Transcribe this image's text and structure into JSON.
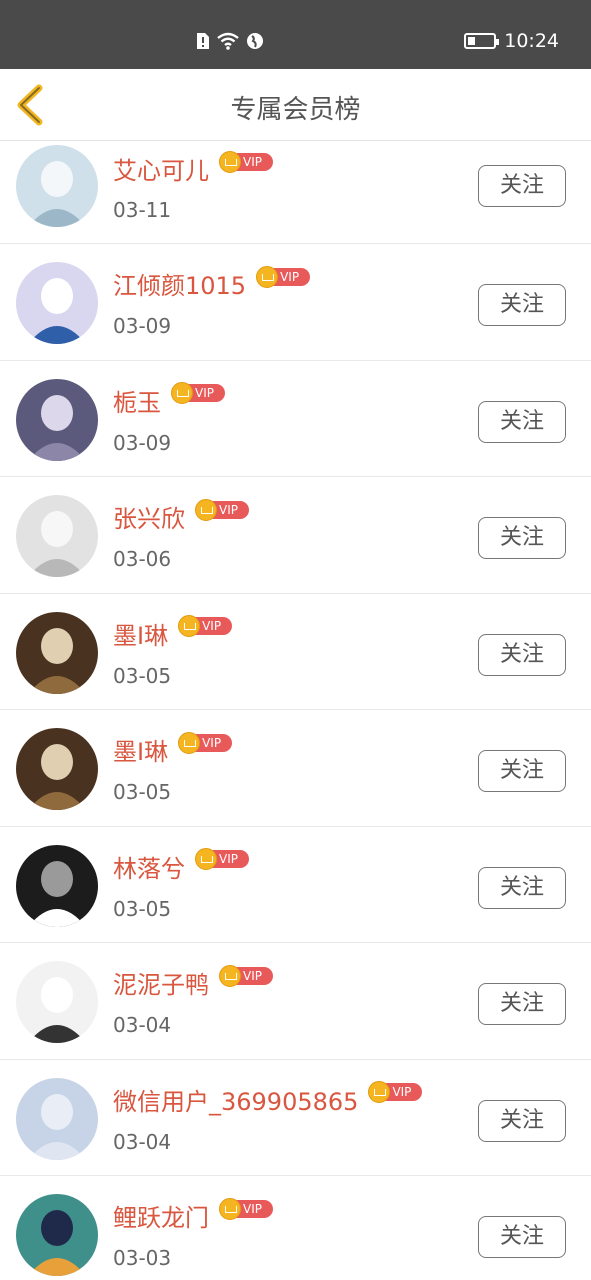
{
  "status_bar": {
    "time": "10:24",
    "battery_level": 0.25
  },
  "header": {
    "title": "专属会员榜",
    "back_icon": "chevron-left-icon"
  },
  "vip_label": "VIP",
  "members": [
    {
      "name": "艾心可儿",
      "date": "03-11",
      "follow": "关注",
      "avatar_colors": [
        "#cfe0ea",
        "#f4f7fa",
        "#9cb8c8"
      ]
    },
    {
      "name": "江倾颜1015",
      "date": "03-09",
      "follow": "关注",
      "avatar_colors": [
        "#d9d6ef",
        "#ffffff",
        "#2f5fa8"
      ]
    },
    {
      "name": "栀玉",
      "date": "03-09",
      "follow": "关注",
      "avatar_colors": [
        "#5c5a7c",
        "#dcd7ea",
        "#8c87a8"
      ]
    },
    {
      "name": "张兴欣",
      "date": "03-06",
      "follow": "关注",
      "avatar_colors": [
        "#e2e2e2",
        "#f7f7f7",
        "#b8b8b8"
      ]
    },
    {
      "name": "墨I琳",
      "date": "03-05",
      "follow": "关注",
      "avatar_colors": [
        "#4a3220",
        "#e0cfb1",
        "#8f6a3c"
      ]
    },
    {
      "name": "墨I琳",
      "date": "03-05",
      "follow": "关注",
      "avatar_colors": [
        "#4a3220",
        "#e0cfb1",
        "#8f6a3c"
      ]
    },
    {
      "name": "林落兮",
      "date": "03-05",
      "follow": "关注",
      "avatar_colors": [
        "#1c1c1c",
        "#9a9a9a",
        "#ffffff"
      ]
    },
    {
      "name": "泥泥子鸭",
      "date": "03-04",
      "follow": "关注",
      "avatar_colors": [
        "#f2f2f2",
        "#ffffff",
        "#333333"
      ]
    },
    {
      "name": "微信用户_369905865",
      "date": "03-04",
      "follow": "关注",
      "avatar_colors": [
        "#c7d3e6",
        "#e9eef6",
        "#dfe6f1"
      ]
    },
    {
      "name": "鲤跃龙门",
      "date": "03-03",
      "follow": "关注",
      "avatar_colors": [
        "#3f8f8a",
        "#1f2a4a",
        "#e8a13a"
      ]
    }
  ]
}
